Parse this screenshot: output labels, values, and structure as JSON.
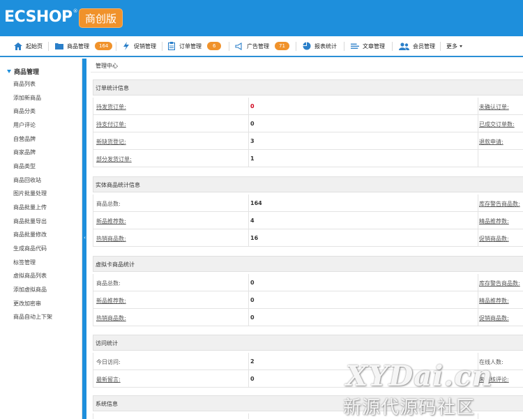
{
  "header": {
    "logo_text": "ECSHOP",
    "logo_reg": "®",
    "edition": "商创版"
  },
  "nav": {
    "home": "起始页",
    "goods": "商品管理",
    "goods_count": "164",
    "promo": "促销管理",
    "orders": "订单管理",
    "orders_count": "6",
    "ads": "广告管理",
    "ads_count": "71",
    "reports": "报表统计",
    "articles": "文章管理",
    "members": "会员管理",
    "more": "更多"
  },
  "sidebar": {
    "title": "商品管理",
    "items": [
      "商品列表",
      "添加新商品",
      "商品分类",
      "用户评论",
      "自营品牌",
      "商家品牌",
      "商品类型",
      "商品回收站",
      "图片批量处理",
      "商品批量上传",
      "商品批量导出",
      "商品批量修改",
      "生成商品代码",
      "标签管理",
      "虚拟商品列表",
      "添加虚拟商品",
      "更改加密串",
      "商品自动上下架"
    ]
  },
  "main": {
    "breadcrumb": "管理中心",
    "sections": [
      {
        "title": "订单统计信息",
        "rows": [
          {
            "label": "待发货订单:",
            "value": "0",
            "right": "未确认订单:"
          },
          {
            "label": "待支付订单:",
            "value": "0",
            "right": "已成交订单数:"
          },
          {
            "label": "新缺货登记:",
            "value": "3",
            "right": "退款申请:"
          },
          {
            "label": "部分发货订单:",
            "value": "1",
            "right": ""
          }
        ]
      },
      {
        "title": "实体商品统计信息",
        "rows": [
          {
            "label": "商品总数:",
            "value": "164",
            "right": "库存警告商品数:"
          },
          {
            "label": "新品推荐数:",
            "value": "4",
            "right": "精品推荐数:"
          },
          {
            "label": "热销商品数:",
            "value": "16",
            "right": "促销商品数:"
          }
        ]
      },
      {
        "title": "虚拟卡商品统计",
        "rows": [
          {
            "label": "商品总数:",
            "value": "0",
            "right": "库存警告商品数:"
          },
          {
            "label": "新品推荐数:",
            "value": "0",
            "right": "精品推荐数:"
          },
          {
            "label": "热销商品数:",
            "value": "0",
            "right": "促销商品数:"
          }
        ]
      },
      {
        "title": "访问统计",
        "rows": [
          {
            "label": "今日访问:",
            "value": "2",
            "right": "在线人数:"
          },
          {
            "label": "最新留言:",
            "value": "0",
            "right": "未审核评论:"
          }
        ]
      },
      {
        "title": "系统信息",
        "rows": []
      }
    ]
  },
  "watermark": {
    "line1": "XYDai.cn",
    "line2": "新源代源码社区"
  },
  "colors": {
    "header_blue": "#1e8fdc",
    "badge_orange": "#f0922b",
    "alert_red": "#d0021b"
  }
}
